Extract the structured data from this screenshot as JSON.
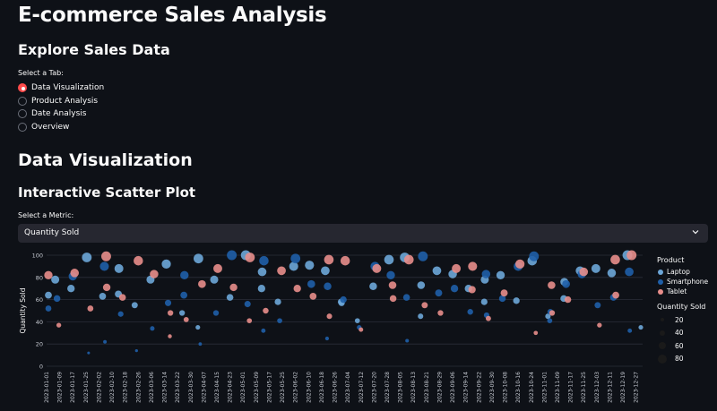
{
  "page": {
    "title": "E-commerce Sales Analysis",
    "subtitle": "Explore Sales Data",
    "tab_label": "Select a Tab:",
    "tabs": [
      {
        "label": "Data Visualization",
        "checked": true
      },
      {
        "label": "Product Analysis",
        "checked": false
      },
      {
        "label": "Date Analysis",
        "checked": false
      },
      {
        "label": "Overview",
        "checked": false
      }
    ],
    "section_title": "Data Visualization",
    "chart_heading": "Interactive Scatter Plot",
    "metric_label": "Select a Metric:",
    "metric_value": "Quantity Sold",
    "accent": "#ff4b4b"
  },
  "chart_data": {
    "type": "scatter",
    "ylabel": "Quantity Sold",
    "xlabel": "",
    "ylim": [
      0,
      100
    ],
    "yticks": [
      0,
      20,
      40,
      60,
      80,
      100
    ],
    "x_type": "date",
    "x_range": [
      "2023-01-01",
      "2023-12-31"
    ],
    "xticks": [
      "2023-01-01",
      "2023-01-09",
      "2023-01-17",
      "2023-01-25",
      "2023-02-02",
      "2023-02-10",
      "2023-02-18",
      "2023-02-26",
      "2023-03-06",
      "2023-03-14",
      "2023-03-22",
      "2023-03-30",
      "2023-04-07",
      "2023-04-15",
      "2023-04-23",
      "2023-05-01",
      "2023-05-09",
      "2023-05-17",
      "2023-05-25",
      "2023-06-02",
      "2023-06-10",
      "2023-06-18",
      "2023-06-26",
      "2023-07-04",
      "2023-07-12",
      "2023-07-20",
      "2023-07-28",
      "2023-08-05",
      "2023-08-13",
      "2023-08-21",
      "2023-08-29",
      "2023-09-06",
      "2023-09-14",
      "2023-09-22",
      "2023-09-30",
      "2023-10-08",
      "2023-10-16",
      "2023-10-24",
      "2023-11-01",
      "2023-11-09",
      "2023-11-17",
      "2023-11-25",
      "2023-12-03",
      "2023-12-11",
      "2023-12-19",
      "2023-12-27"
    ],
    "grid": true,
    "legend_position": "right",
    "color_legend_title": "Product",
    "size_legend_title": "Quantity Sold",
    "size_legend_values": [
      20,
      40,
      60,
      80
    ],
    "series": [
      {
        "name": "Laptop",
        "color": "#6da7d8",
        "y": [
          64,
          78,
          70,
          98,
          63,
          65,
          88,
          55,
          78,
          92,
          48,
          35,
          97,
          78,
          62,
          100,
          70,
          85,
          58,
          90,
          91,
          86,
          58,
          57,
          41,
          72,
          96,
          98,
          45,
          73,
          86,
          83,
          70,
          58,
          78,
          82,
          59,
          95,
          45,
          61,
          76,
          86,
          88,
          84,
          100,
          35
        ]
      },
      {
        "name": "Smartphone",
        "color": "#1f5fa8",
        "y": [
          52,
          61,
          81,
          12,
          90,
          22,
          47,
          14,
          34,
          57,
          64,
          82,
          20,
          48,
          100,
          56,
          32,
          95,
          41,
          97,
          74,
          25,
          72,
          60,
          35,
          90,
          82,
          62,
          23,
          99,
          66,
          70,
          49,
          83,
          46,
          61,
          90,
          99,
          41,
          49,
          74,
          83,
          55,
          62,
          85,
          32
        ]
      },
      {
        "name": "Tablet",
        "color": "#e88e8b",
        "y": [
          82,
          37,
          84,
          52,
          99,
          71,
          62,
          95,
          83,
          27,
          48,
          42,
          74,
          88,
          71,
          41,
          98,
          50,
          86,
          70,
          63,
          96,
          45,
          95,
          33,
          88,
          73,
          61,
          96,
          55,
          48,
          88,
          69,
          90,
          43,
          66,
          92,
          30,
          73,
          48,
          60,
          85,
          37,
          96,
          64,
          100
        ]
      }
    ]
  }
}
